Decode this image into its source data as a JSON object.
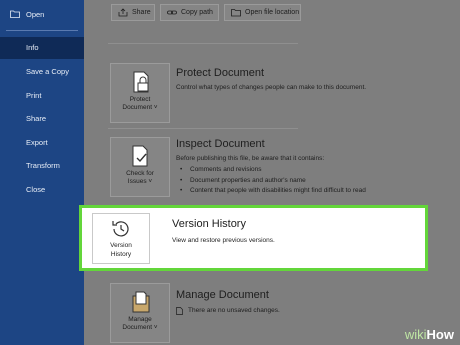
{
  "sidebar": {
    "open_label": "Open",
    "items": [
      {
        "label": "Info",
        "active": true
      },
      {
        "label": "Save a Copy"
      },
      {
        "label": "Print"
      },
      {
        "label": "Share"
      },
      {
        "label": "Export"
      },
      {
        "label": "Transform"
      },
      {
        "label": "Close"
      }
    ]
  },
  "toolbar": {
    "share_label": "Share",
    "copy_path_label": "Copy path",
    "open_location_label": "Open file location"
  },
  "sections": {
    "protect": {
      "button_line1": "Protect",
      "button_line2": "Document ˅",
      "title": "Protect Document",
      "description": "Control what types of changes people can make to this document."
    },
    "inspect": {
      "button_line1": "Check for",
      "button_line2": "Issues ˅",
      "title": "Inspect Document",
      "description": "Before publishing this file, be aware that it contains:",
      "bullets": [
        "Comments and revisions",
        "Document properties and author's name",
        "Content that people with disabilities might find difficult to read"
      ]
    },
    "version": {
      "button_line1": "Version",
      "button_line2": "History",
      "title": "Version History",
      "description": "View and restore previous versions."
    },
    "manage": {
      "button_line1": "Manage",
      "button_line2": "Document ˅",
      "title": "Manage Document",
      "description": "There are no unsaved changes."
    }
  },
  "watermark": {
    "wiki": "wiki",
    "how": "How"
  },
  "colors": {
    "sidebar": "#1d4584",
    "highlight": "#63d63a"
  }
}
